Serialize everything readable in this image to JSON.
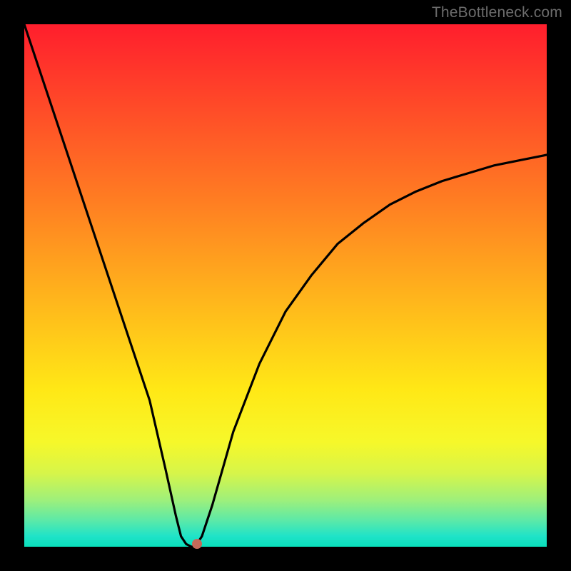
{
  "attribution": "TheBottleneck.com",
  "palette": {
    "background": "#000000",
    "gradient_top": "#ff1e2d",
    "gradient_bottom": "#0adfbb",
    "curve_stroke": "#000000",
    "marker_fill": "#c46a5a"
  },
  "chart_data": {
    "type": "line",
    "title": "",
    "xlabel": "",
    "ylabel": "",
    "xlim": [
      0,
      100
    ],
    "ylim": [
      0,
      100
    ],
    "grid": false,
    "series": [
      {
        "name": "bottleneck-curve",
        "x": [
          0,
          4,
          8,
          12,
          16,
          20,
          24,
          27,
          29,
          30,
          31,
          32,
          32.5,
          33,
          34,
          36,
          40,
          45,
          50,
          55,
          60,
          65,
          70,
          75,
          80,
          85,
          90,
          95,
          100
        ],
        "values": [
          100,
          88,
          76,
          64,
          52,
          40,
          28,
          15,
          6,
          2,
          0.5,
          0,
          0,
          0.5,
          2,
          8,
          22,
          35,
          45,
          52,
          58,
          62,
          65.5,
          68,
          70,
          71.5,
          73,
          74,
          75
        ]
      }
    ],
    "annotations": [
      {
        "name": "min-marker",
        "x": 33,
        "y": 0.5
      }
    ]
  }
}
